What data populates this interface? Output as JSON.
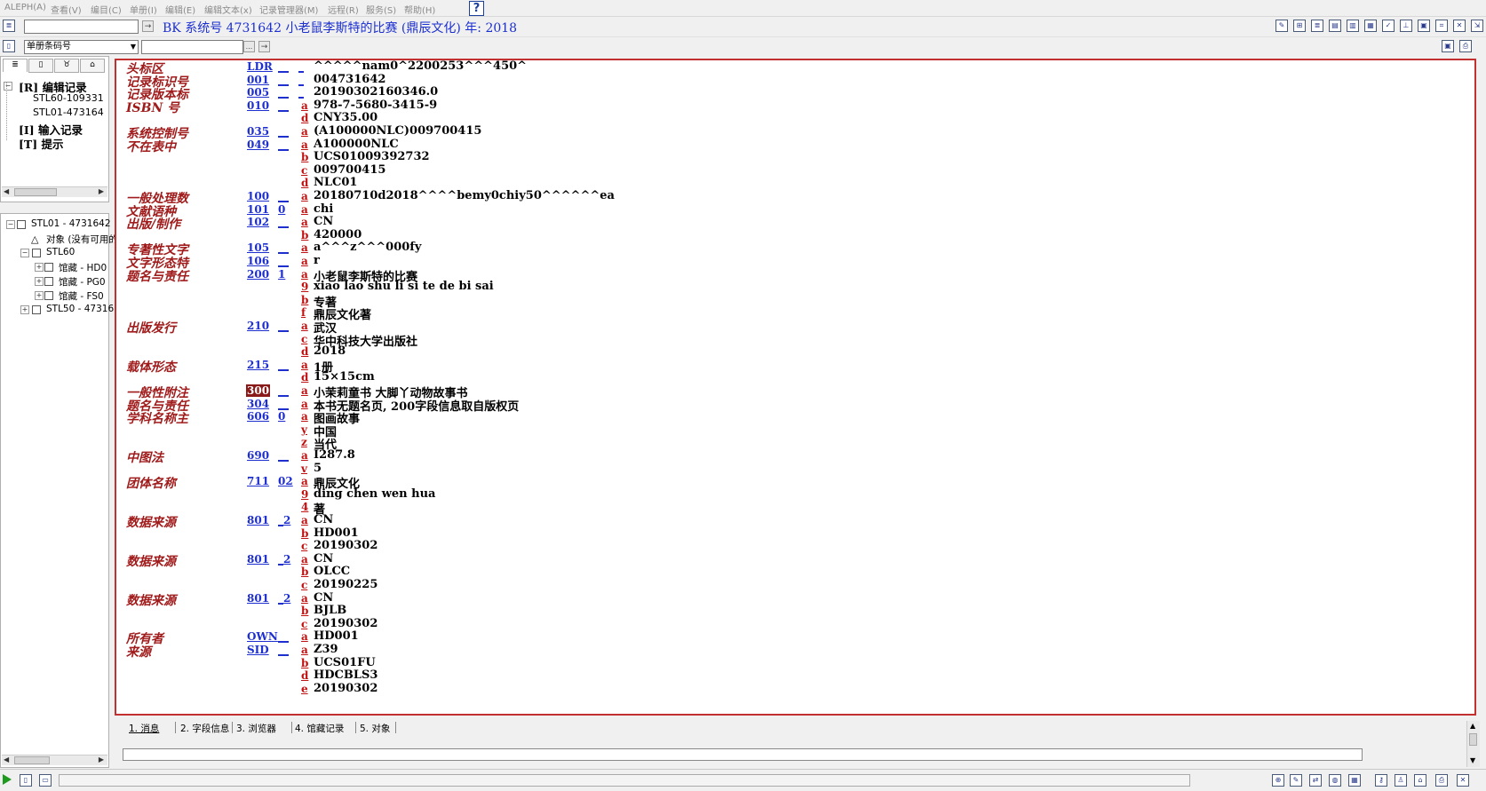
{
  "menu": [
    {
      "label": "ALEPH(A)",
      "name": "menu-aleph"
    },
    {
      "label": "查看(V)",
      "name": "menu-view"
    },
    {
      "label": "编目(C)",
      "name": "menu-catalog"
    },
    {
      "label": "单册(I)",
      "name": "menu-items"
    },
    {
      "label": "编辑(E)",
      "name": "menu-edit"
    },
    {
      "label": "编辑文本(x)",
      "name": "menu-edit-text"
    },
    {
      "label": "记录管理器(M)",
      "name": "menu-record-manager"
    },
    {
      "label": "远程(R)",
      "name": "menu-remote"
    },
    {
      "label": "服务(S)",
      "name": "menu-services"
    },
    {
      "label": "帮助(H)",
      "name": "menu-help"
    }
  ],
  "help_button": "?",
  "toolbar": {
    "search_value": "",
    "go_arrow": "→",
    "record_title": "BK 系统号 4731642 小老鼠李斯特的比赛 (鼎辰文化) 年: 2018",
    "barcode_select": "单册条码号",
    "barcode_value": "",
    "ellipsis": "...",
    "barcode_go": "→"
  },
  "tree_tabs": [
    "≣",
    "▯",
    "♉",
    "⌂"
  ],
  "tree_top": [
    {
      "label": "[R] 编辑记录",
      "bold": true,
      "name": "tree-item-edit-record"
    },
    {
      "label": "STL60-109331",
      "bold": false,
      "name": "tree-item-stl60"
    },
    {
      "label": "STL01-473164",
      "bold": false,
      "name": "tree-item-stl01"
    },
    {
      "label": "[I] 输入记录",
      "bold": true,
      "name": "tree-item-input-record"
    },
    {
      "label": "[T] 提示",
      "bold": true,
      "name": "tree-item-tips"
    }
  ],
  "tree_bottom": [
    {
      "label": "STL01 - 4731642",
      "name": "nav-stl01"
    },
    {
      "label": "对象 (没有可用的",
      "name": "nav-objects"
    },
    {
      "label": "STL60",
      "name": "nav-stl60"
    },
    {
      "label": "馆藏 - HD0",
      "name": "nav-holding-hd"
    },
    {
      "label": "馆藏 - PG0",
      "name": "nav-holding-pg"
    },
    {
      "label": "馆藏 - FS0",
      "name": "nav-holding-fs"
    },
    {
      "label": "STL50 - 47316",
      "name": "nav-stl50"
    }
  ],
  "record_rows": [
    {
      "name": "头标区",
      "tag": "LDR",
      "i1": "__",
      "i2": "_",
      "sub": "",
      "val": "^^^^^nam0^2200253^^^450^"
    },
    {
      "name": "记录标识号",
      "tag": "001",
      "i1": "__",
      "i2": "_",
      "sub": "",
      "val": "004731642"
    },
    {
      "name": "记录版本标",
      "tag": "005",
      "i1": "__",
      "i2": "_",
      "sub": "",
      "val": "20190302160346.0"
    },
    {
      "name": "ISBN 号",
      "tag": "010",
      "i1": "__",
      "i2": "",
      "sub": "a",
      "val": "978-7-5680-3415-9"
    },
    {
      "name": "",
      "tag": "",
      "i1": "",
      "i2": "",
      "sub": "d",
      "val": "CNY35.00"
    },
    {
      "name": "系统控制号",
      "tag": "035",
      "i1": "__",
      "i2": "",
      "sub": "a",
      "val": "(A100000NLC)009700415"
    },
    {
      "name": "不在表中",
      "tag": "049",
      "i1": "__",
      "i2": "",
      "sub": "a",
      "val": "A100000NLC"
    },
    {
      "name": "",
      "tag": "",
      "i1": "",
      "i2": "",
      "sub": "b",
      "val": "UCS01009392732"
    },
    {
      "name": "",
      "tag": "",
      "i1": "",
      "i2": "",
      "sub": "c",
      "val": "009700415"
    },
    {
      "name": "",
      "tag": "",
      "i1": "",
      "i2": "",
      "sub": "d",
      "val": "NLC01"
    },
    {
      "name": "一般处理数",
      "tag": "100",
      "i1": "__",
      "i2": "",
      "sub": "a",
      "val": "20180710d2018^^^^bemy0chiy50^^^^^^ea"
    },
    {
      "name": "文献语种",
      "tag": "101",
      "i1": "0",
      "i2": "",
      "sub": "a",
      "val": "chi"
    },
    {
      "name": "出版/制作",
      "tag": "102",
      "i1": "__",
      "i2": "",
      "sub": "a",
      "val": "CN"
    },
    {
      "name": "",
      "tag": "",
      "i1": "",
      "i2": "",
      "sub": "b",
      "val": "420000"
    },
    {
      "name": "专著性文字",
      "tag": "105",
      "i1": "__",
      "i2": "",
      "sub": "a",
      "val": "a^^^z^^^000fy"
    },
    {
      "name": "文字形态特",
      "tag": "106",
      "i1": "__",
      "i2": "",
      "sub": "a",
      "val": "r"
    },
    {
      "name": "题名与责任",
      "tag": "200",
      "i1": "1",
      "i2": "",
      "sub": "a",
      "val": "小老鼠李斯特的比赛"
    },
    {
      "name": "",
      "tag": "",
      "i1": "",
      "i2": "",
      "sub": "9",
      "val": "xiao lao shu li si te de bi sai"
    },
    {
      "name": "",
      "tag": "",
      "i1": "",
      "i2": "",
      "sub": "b",
      "val": "专著"
    },
    {
      "name": "",
      "tag": "",
      "i1": "",
      "i2": "",
      "sub": "f",
      "val": "鼎辰文化著"
    },
    {
      "name": "出版发行",
      "tag": "210",
      "i1": "__",
      "i2": "",
      "sub": "a",
      "val": "武汉"
    },
    {
      "name": "",
      "tag": "",
      "i1": "",
      "i2": "",
      "sub": "c",
      "val": "华中科技大学出版社"
    },
    {
      "name": "",
      "tag": "",
      "i1": "",
      "i2": "",
      "sub": "d",
      "val": "2018"
    },
    {
      "name": "载体形态",
      "tag": "215",
      "i1": "__",
      "i2": "",
      "sub": "a",
      "val": "1册"
    },
    {
      "name": "",
      "tag": "",
      "i1": "",
      "i2": "",
      "sub": "d",
      "val": "15×15cm"
    },
    {
      "name": "一般性附注",
      "tag": "300",
      "i1": "__",
      "i2": "",
      "sub": "a",
      "val": "小茉莉童书 大脚丫动物故事书",
      "selected": true
    },
    {
      "name": "题名与责任",
      "tag": "304",
      "i1": "__",
      "i2": "",
      "sub": "a",
      "val": "本书无题名页, 200字段信息取自版权页"
    },
    {
      "name": "学科名称主",
      "tag": "606",
      "i1": "0",
      "i2": "",
      "sub": "a",
      "val": "图画故事"
    },
    {
      "name": "",
      "tag": "",
      "i1": "",
      "i2": "",
      "sub": "y",
      "val": "中国"
    },
    {
      "name": "",
      "tag": "",
      "i1": "",
      "i2": "",
      "sub": "z",
      "val": "当代"
    },
    {
      "name": "中图法",
      "tag": "690",
      "i1": "__",
      "i2": "",
      "sub": "a",
      "val": "I287.8"
    },
    {
      "name": "",
      "tag": "",
      "i1": "",
      "i2": "",
      "sub": "v",
      "val": "5"
    },
    {
      "name": "团体名称",
      "tag": "711",
      "i1": "02",
      "i2": "",
      "sub": "a",
      "val": "鼎辰文化"
    },
    {
      "name": "",
      "tag": "",
      "i1": "",
      "i2": "",
      "sub": "9",
      "val": "ding chen wen hua"
    },
    {
      "name": "",
      "tag": "",
      "i1": "",
      "i2": "",
      "sub": "4",
      "val": "著"
    },
    {
      "name": "数据来源",
      "tag": "801",
      "i1": "_2",
      "i2": "",
      "sub": "a",
      "val": "CN"
    },
    {
      "name": "",
      "tag": "",
      "i1": "",
      "i2": "",
      "sub": "b",
      "val": "HD001"
    },
    {
      "name": "",
      "tag": "",
      "i1": "",
      "i2": "",
      "sub": "c",
      "val": "20190302"
    },
    {
      "name": "数据来源",
      "tag": "801",
      "i1": "_2",
      "i2": "",
      "sub": "a",
      "val": "CN"
    },
    {
      "name": "",
      "tag": "",
      "i1": "",
      "i2": "",
      "sub": "b",
      "val": "OLCC"
    },
    {
      "name": "",
      "tag": "",
      "i1": "",
      "i2": "",
      "sub": "c",
      "val": "20190225"
    },
    {
      "name": "数据来源",
      "tag": "801",
      "i1": "_2",
      "i2": "",
      "sub": "a",
      "val": "CN"
    },
    {
      "name": "",
      "tag": "",
      "i1": "",
      "i2": "",
      "sub": "b",
      "val": "BJLB"
    },
    {
      "name": "",
      "tag": "",
      "i1": "",
      "i2": "",
      "sub": "c",
      "val": "20190302"
    },
    {
      "name": "所有者",
      "tag": "OWN",
      "i1": "__",
      "i2": "",
      "sub": "a",
      "val": "HD001"
    },
    {
      "name": "来源",
      "tag": "SID",
      "i1": "__",
      "i2": "",
      "sub": "a",
      "val": "Z39"
    },
    {
      "name": "",
      "tag": "",
      "i1": "",
      "i2": "",
      "sub": "b",
      "val": "UCS01FU"
    },
    {
      "name": "",
      "tag": "",
      "i1": "",
      "i2": "",
      "sub": "d",
      "val": "HDCBLS3"
    },
    {
      "name": "",
      "tag": "",
      "i1": "",
      "i2": "",
      "sub": "e",
      "val": "20190302"
    }
  ],
  "bottom_tabs": [
    {
      "label": "1. 消息",
      "active": true
    },
    {
      "label": "2. 字段信息",
      "active": false
    },
    {
      "label": "3. 浏览器",
      "active": false
    },
    {
      "label": "4. 馆藏记录",
      "active": false
    },
    {
      "label": "5. 对象",
      "active": false
    }
  ],
  "colors": {
    "field_name": "#a01c1c",
    "tag_link": "#1e2fd0",
    "subfield": "#c01010",
    "frame_border": "#c23030",
    "selected_tag_bg": "#8a1a1a"
  }
}
